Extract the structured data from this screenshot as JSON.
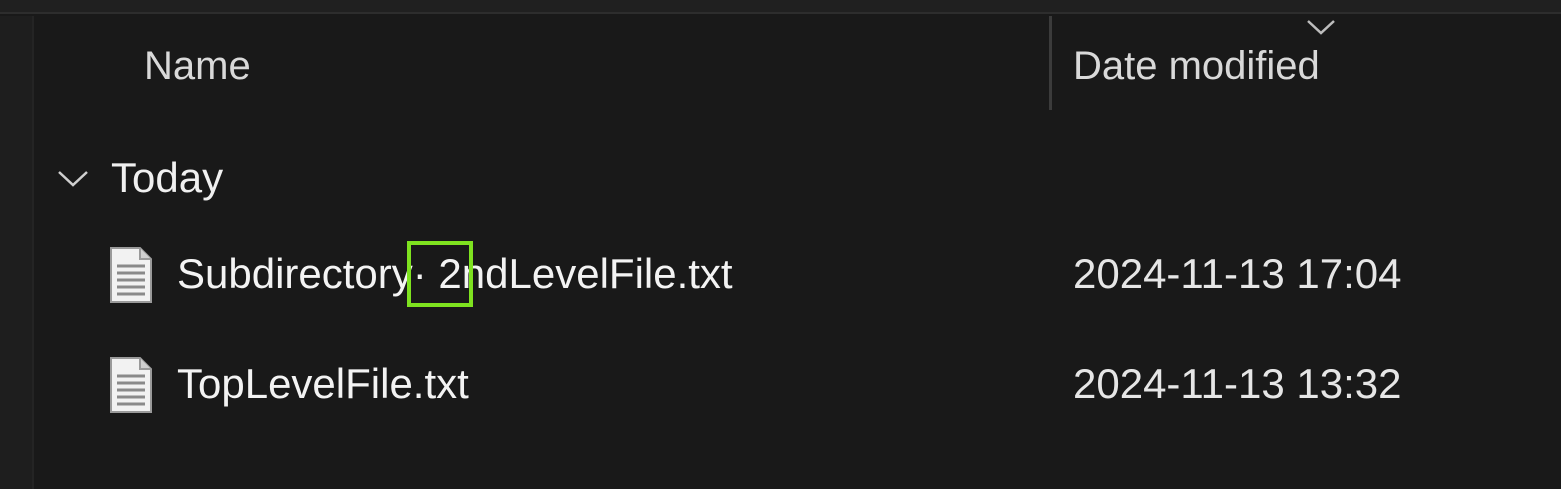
{
  "header": {
    "name_label": "Name",
    "date_label": "Date modified"
  },
  "group": {
    "label": "Today"
  },
  "files": [
    {
      "name": "Subdirectory· 2ndLevelFile.txt",
      "date": "2024-11-13 17:04",
      "icon": "text-file-icon"
    },
    {
      "name": "TopLevelFile.txt",
      "date": "2024-11-13 13:32",
      "icon": "text-file-icon"
    }
  ],
  "colors": {
    "background": "#191919",
    "highlight": "#7ee21f",
    "text": "#f3f3f3"
  }
}
